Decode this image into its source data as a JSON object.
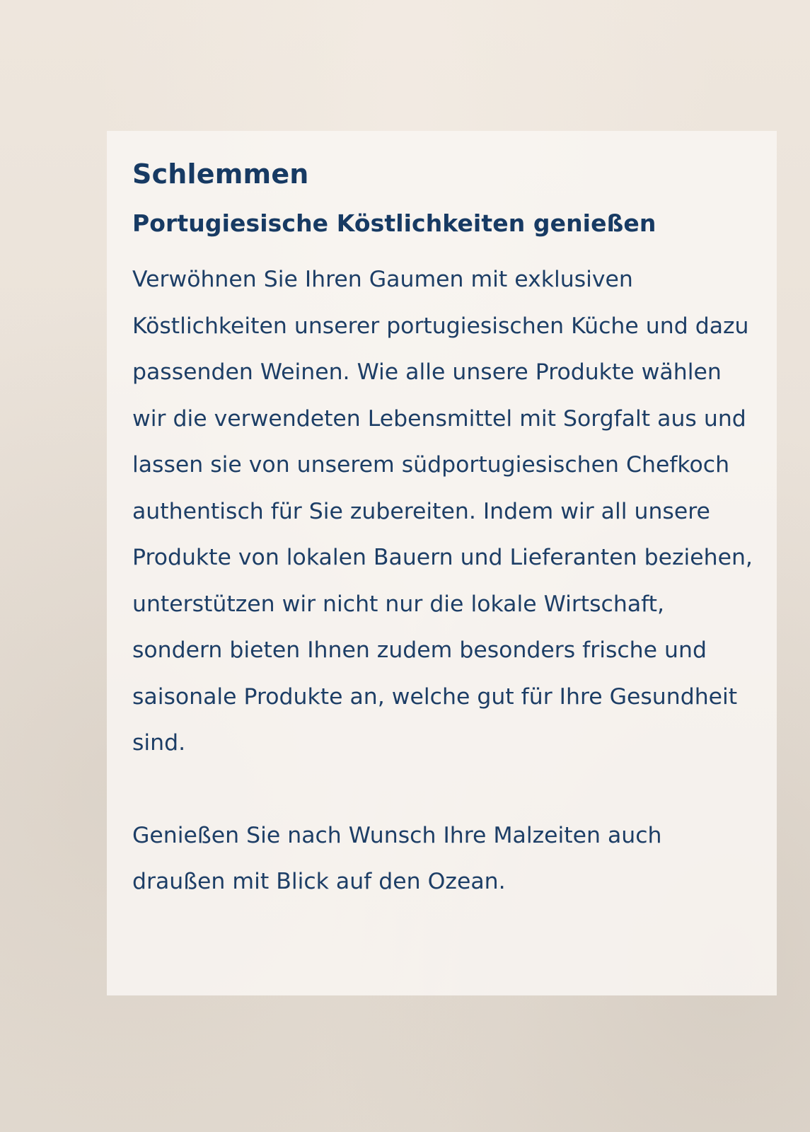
{
  "card": {
    "title": "Schlemmen",
    "subtitle": "Portugiesische Köstlichkeiten genießen",
    "paragraph_1": "Verwöhnen Sie Ihren Gaumen mit exklusiven Köstlichkeiten unserer portugiesischen Küche und dazu passenden Weinen. Wie alle unsere Produkte wählen wir die verwendeten Lebensmittel mit Sorgfalt aus und lassen sie von unserem südportugiesischen Chefkoch authentisch für Sie zubereiten. Indem wir all unsere Produkte von lokalen Bauern und Lieferanten beziehen, unterstützen wir nicht nur die lokale Wirtschaft, sondern bieten Ihnen zudem besonders frische und saisonale Produkte an, welche gut für Ihre Gesundheit sind.",
    "paragraph_2": "Genießen Sie nach Wunsch Ihre Malzeiten auch draußen mit Blick auf den Ozean."
  },
  "colors": {
    "text": "#173a63",
    "background": "#e9e1d8",
    "card": "#f8f5f1"
  }
}
